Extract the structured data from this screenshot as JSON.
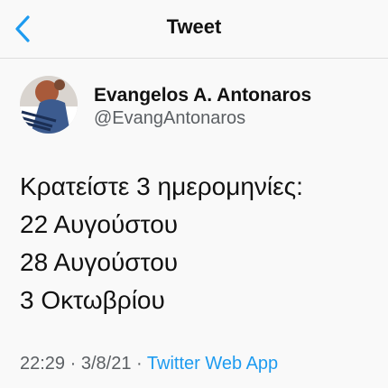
{
  "nav": {
    "title": "Tweet"
  },
  "author": {
    "display_name": "Evangelos A. Antonaros",
    "handle": "@EvangAntonaros"
  },
  "tweet": {
    "lines": [
      "Κρατείστε 3 ημερομηνίες:",
      "22 Αυγούστου",
      "28 Αυγούστου",
      "3 Οκτωβρίου"
    ]
  },
  "meta": {
    "time": "22:29",
    "separator": "·",
    "date": "3/8/21",
    "source": "Twitter Web App"
  },
  "colors": {
    "accent": "#1d9bf0",
    "secondary_text": "#5b5f63",
    "background": "#f9f9f9"
  },
  "icons": {
    "back": "chevron-left-icon"
  }
}
